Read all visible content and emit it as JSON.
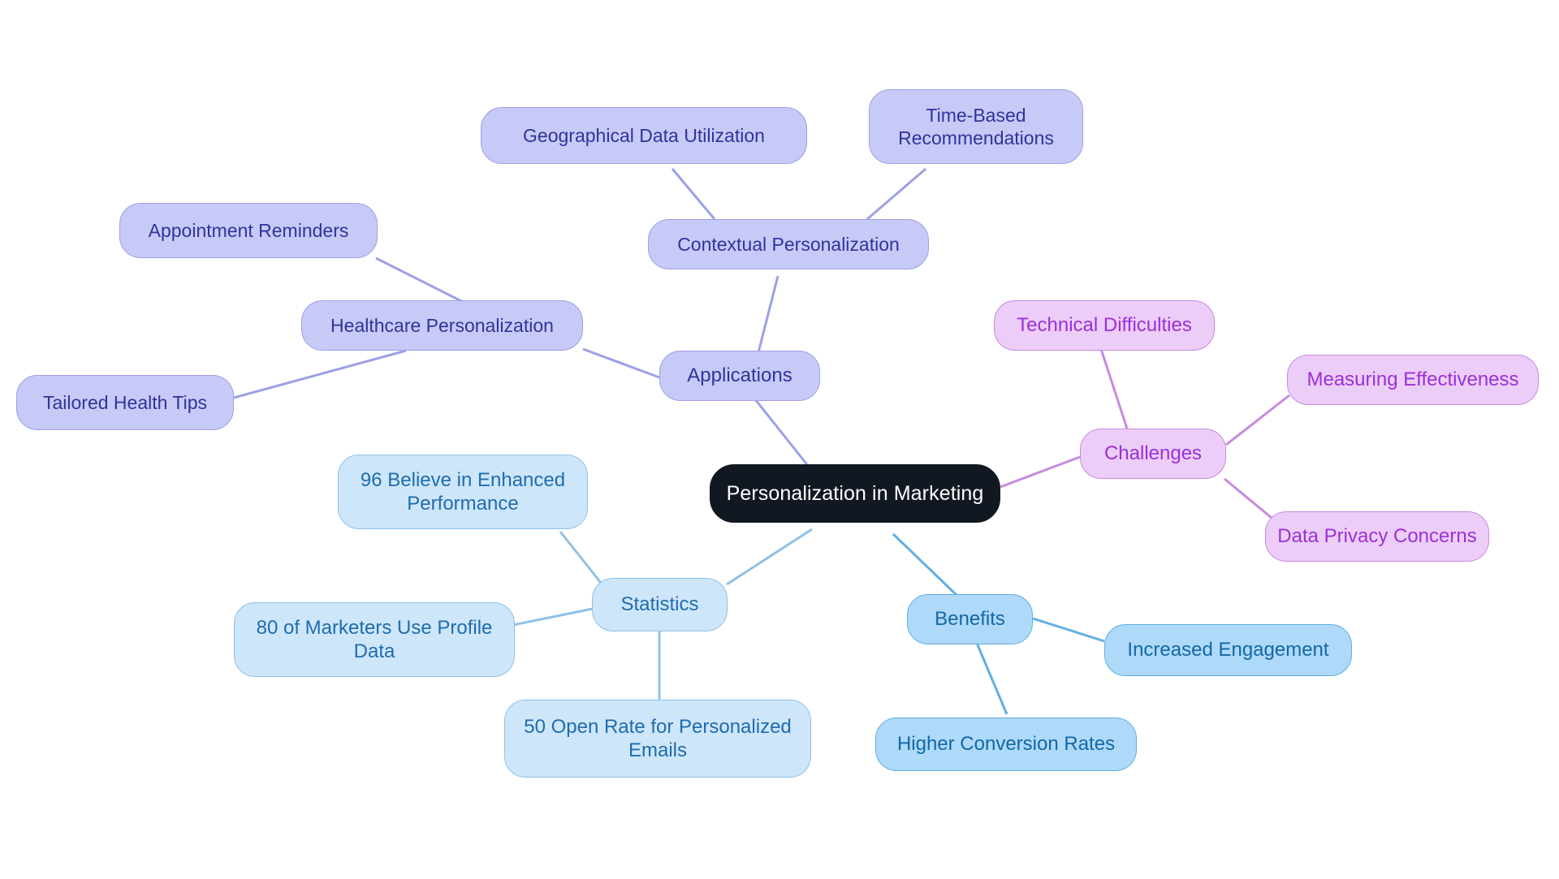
{
  "diagram": {
    "type": "mindmap",
    "title": "Personalization in Marketing",
    "background": "#ffffff",
    "palette": {
      "root_fill": "#111821",
      "root_text": "#ffffff",
      "lavender_fill": "#c7caf7",
      "lavender_border": "#9ca0e6",
      "lavender_text": "#31339c",
      "violet_fill": "#eccdf8",
      "violet_border": "#c88ae0",
      "violet_text": "#9b30d9",
      "lightblue_fill": "#cee6fa",
      "lightblue_border": "#8fc1e8",
      "lightblue_text": "#1f6cb0",
      "skyblue_fill": "#aed9f8",
      "skyblue_border": "#62afe2",
      "skyblue_text": "#1368a8"
    }
  },
  "nodes": {
    "root": {
      "label": "Personalization in Marketing"
    },
    "applications": {
      "label": "Applications"
    },
    "contextual_personalization": {
      "label": "Contextual Personalization"
    },
    "geographical_data_utilization": {
      "label": "Geographical Data Utilization"
    },
    "time_based_recommendations": {
      "label": "Time-Based\nRecommendations"
    },
    "healthcare_personalization": {
      "label": "Healthcare Personalization"
    },
    "appointment_reminders": {
      "label": "Appointment Reminders"
    },
    "tailored_health_tips": {
      "label": "Tailored Health Tips"
    },
    "challenges": {
      "label": "Challenges"
    },
    "technical_difficulties": {
      "label": "Technical Difficulties"
    },
    "measuring_effectiveness": {
      "label": "Measuring Effectiveness"
    },
    "data_privacy_concerns": {
      "label": "Data Privacy Concerns"
    },
    "statistics": {
      "label": "Statistics"
    },
    "stat_enhanced_performance": {
      "label": "96 Believe in Enhanced\nPerformance"
    },
    "stat_profile_data": {
      "label": "80 of Marketers Use Profile\nData"
    },
    "stat_open_rate": {
      "label": "50 Open Rate for Personalized\nEmails"
    },
    "benefits": {
      "label": "Benefits"
    },
    "increased_engagement": {
      "label": "Increased Engagement"
    },
    "higher_conversion_rates": {
      "label": "Higher Conversion Rates"
    }
  },
  "branches": [
    {
      "name": "Applications",
      "color": "#9ca0e6",
      "children": [
        "Contextual Personalization",
        "Geographical Data Utilization",
        "Time-Based Recommendations",
        "Healthcare Personalization",
        "Appointment Reminders",
        "Tailored Health Tips"
      ]
    },
    {
      "name": "Challenges",
      "color": "#c88ae0",
      "children": [
        "Technical Difficulties",
        "Measuring Effectiveness",
        "Data Privacy Concerns"
      ]
    },
    {
      "name": "Statistics",
      "color": "#8fc1e8",
      "children": [
        "96 Believe in Enhanced Performance",
        "80 of Marketers Use Profile Data",
        "50 Open Rate for Personalized Emails"
      ]
    },
    {
      "name": "Benefits",
      "color": "#62afe2",
      "children": [
        "Increased Engagement",
        "Higher Conversion Rates"
      ]
    }
  ]
}
